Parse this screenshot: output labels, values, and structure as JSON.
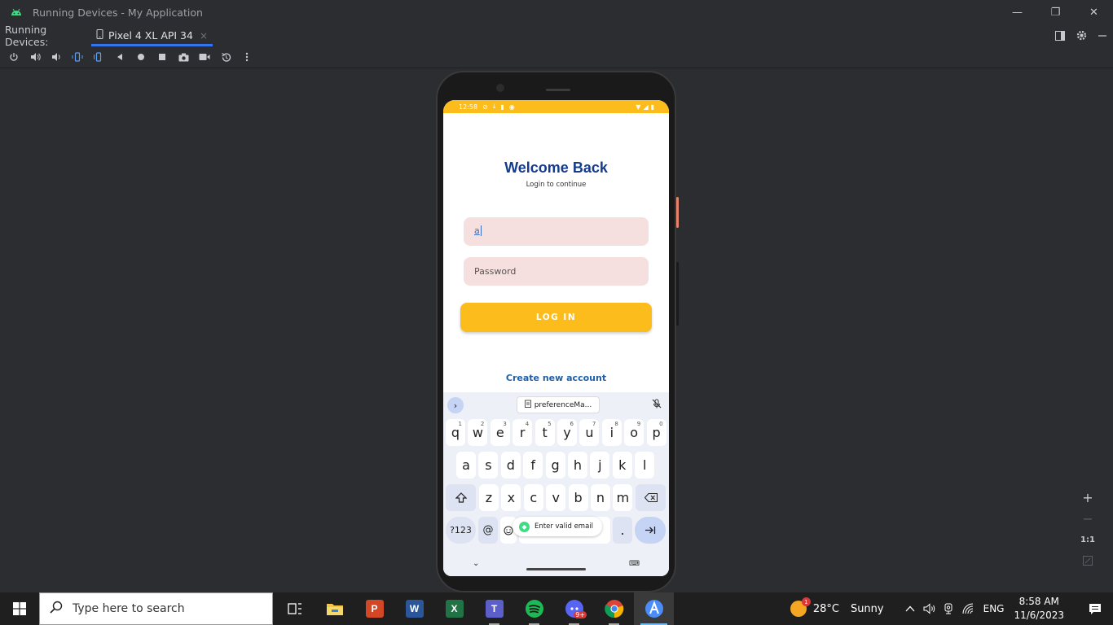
{
  "window": {
    "title": "Running Devices - My Application",
    "controls": {
      "minimize": "—",
      "restore": "❐",
      "close": "✕"
    }
  },
  "tabs": {
    "label": "Running Devices:",
    "device_tab": "Pixel 4 XL API 34",
    "close_glyph": "×"
  },
  "toolbar_icons": [
    "power-icon",
    "volume-up-icon",
    "volume-down-icon",
    "rotate-left-icon",
    "rotate-right-icon",
    "back-icon",
    "home-icon",
    "overview-icon",
    "screenshot-icon",
    "screen-record-icon",
    "reset-icon",
    "more-icon"
  ],
  "zoom": {
    "plus": "+",
    "minus": "−",
    "one_to_one": "1:1"
  },
  "phone": {
    "status": {
      "time": "12:58"
    },
    "app": {
      "title": "Welcome Back",
      "subtitle": "Login to continue",
      "email_value": "a",
      "password_placeholder": "Password",
      "login_label": "LOG IN",
      "create_account": "Create new account"
    },
    "keyboard": {
      "suggestion": "preferenceMa...",
      "row1": [
        "q",
        "w",
        "e",
        "r",
        "t",
        "y",
        "u",
        "i",
        "o",
        "p"
      ],
      "row1_numbers": [
        "1",
        "2",
        "3",
        "4",
        "5",
        "6",
        "7",
        "8",
        "9",
        "0"
      ],
      "row2": [
        "a",
        "s",
        "d",
        "f",
        "g",
        "h",
        "j",
        "k",
        "l"
      ],
      "row3": [
        "z",
        "x",
        "c",
        "v",
        "b",
        "n",
        "m"
      ],
      "symbols_key": "?123",
      "at_key": "@",
      "period_key": ".",
      "toast": "Enter valid email"
    }
  },
  "taskbar": {
    "search_placeholder": "Type here to search",
    "weather_temp": "28°C",
    "weather_desc": "Sunny",
    "weather_badge": "1",
    "language": "ENG",
    "time": "8:58 AM",
    "date": "11/6/2023",
    "teams_badge": "9+"
  },
  "colors": {
    "accent": "#fbbc1c",
    "title_blue": "#143b8c",
    "link_blue": "#1f5fa8",
    "field_bg": "#f5dfdf",
    "ide_bg": "#2b2d30"
  }
}
